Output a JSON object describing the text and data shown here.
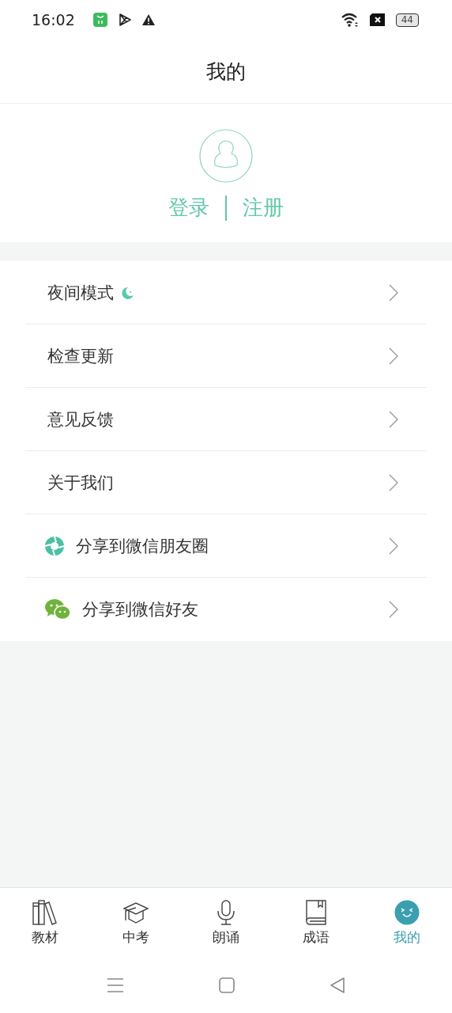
{
  "status_bar": {
    "time": "16:02",
    "battery": "44"
  },
  "title": "我的",
  "profile": {
    "login": "登录",
    "register": "注册"
  },
  "menu": [
    {
      "label": "夜间模式",
      "kind": "night"
    },
    {
      "label": "检查更新",
      "kind": "plain"
    },
    {
      "label": "意见反馈",
      "kind": "plain"
    },
    {
      "label": "关于我们",
      "kind": "plain"
    },
    {
      "label": "分享到微信朋友圈",
      "kind": "moments"
    },
    {
      "label": "分享到微信好友",
      "kind": "wechat"
    }
  ],
  "tabs": [
    {
      "label": "教材",
      "kind": "books",
      "selected": false
    },
    {
      "label": "中考",
      "kind": "cap",
      "selected": false
    },
    {
      "label": "朗诵",
      "kind": "mic",
      "selected": false
    },
    {
      "label": "成语",
      "kind": "book",
      "selected": false
    },
    {
      "label": "我的",
      "kind": "face",
      "selected": true
    }
  ]
}
